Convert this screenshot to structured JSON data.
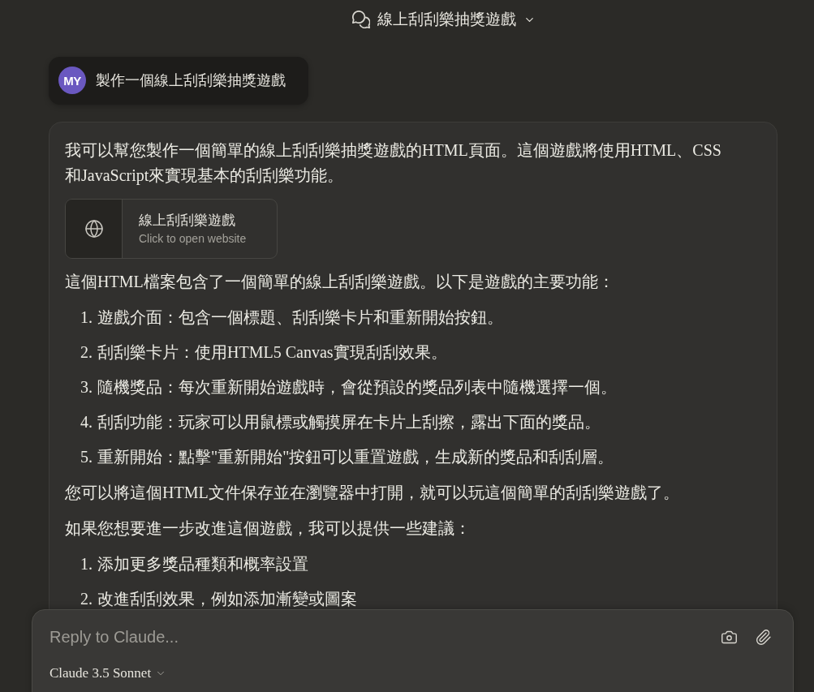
{
  "header": {
    "title": "線上刮刮樂抽獎遊戲"
  },
  "user_message": {
    "avatar": "MY",
    "text": "製作一個線上刮刮樂抽獎遊戲"
  },
  "assistant_message": {
    "blocks": [
      {
        "kind": "paragraph",
        "text": "我可以幫您製作一個簡單的線上刮刮樂抽獎遊戲的HTML頁面。這個遊戲將使用HTML、CSS和JavaScript來實現基本的刮刮樂功能。"
      },
      {
        "kind": "artifact",
        "title": "線上刮刮樂遊戲",
        "subtitle": "Click to open website"
      },
      {
        "kind": "paragraph",
        "text": "這個HTML檔案包含了一個簡單的線上刮刮樂遊戲。以下是遊戲的主要功能："
      },
      {
        "kind": "list",
        "items": [
          {
            "number": "1.",
            "text": "遊戲介面：包含一個標題、刮刮樂卡片和重新開始按鈕。"
          },
          {
            "number": "2.",
            "text": "刮刮樂卡片：使用HTML5 Canvas實現刮刮效果。"
          },
          {
            "number": "3.",
            "text": "隨機獎品：每次重新開始遊戲時，會從預設的獎品列表中隨機選擇一個。"
          },
          {
            "number": "4.",
            "text": "刮刮功能：玩家可以用鼠標或觸摸屏在卡片上刮擦，露出下面的獎品。"
          },
          {
            "number": "5.",
            "text": "重新開始：點擊\"重新開始\"按鈕可以重置遊戲，生成新的獎品和刮刮層。"
          }
        ]
      },
      {
        "kind": "paragraph",
        "text": "您可以將這個HTML文件保存並在瀏覽器中打開，就可以玩這個簡單的刮刮樂遊戲了。"
      },
      {
        "kind": "paragraph",
        "text": "如果您想要進一步改進這個遊戲，我可以提供一些建議："
      },
      {
        "kind": "list",
        "items": [
          {
            "number": "1.",
            "text": "添加更多獎品種類和概率設置"
          },
          {
            "number": "2.",
            "text": "改進刮刮效果，例如添加漸變或圖案"
          }
        ]
      }
    ]
  },
  "composer": {
    "placeholder": "Reply to Claude...",
    "model": "Claude 3.5 Sonnet"
  }
}
